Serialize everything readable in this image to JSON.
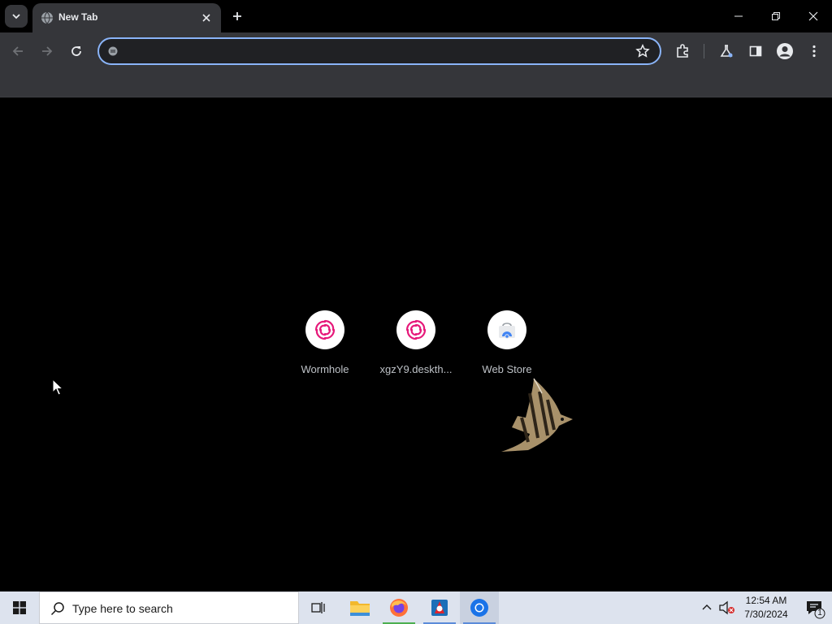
{
  "browser": {
    "tab": {
      "title": "New Tab"
    },
    "omnibox": {
      "value": "",
      "placeholder": ""
    }
  },
  "shortcuts": [
    {
      "label": "Wormhole",
      "icon": "wormhole-logo-icon"
    },
    {
      "label": "xgzY9.deskth...",
      "icon": "wormhole-logo-icon"
    },
    {
      "label": "Web Store",
      "icon": "chrome-web-store-icon"
    }
  ],
  "taskbar": {
    "search_placeholder": "Type here to search",
    "time": "12:54 AM",
    "date": "7/30/2024",
    "notification_count": "1"
  },
  "colors": {
    "accent": "#8ab4f8",
    "toolbar": "#35363a",
    "taskbar": "#dde3ee",
    "wormhole_pink": "#e6197a"
  }
}
